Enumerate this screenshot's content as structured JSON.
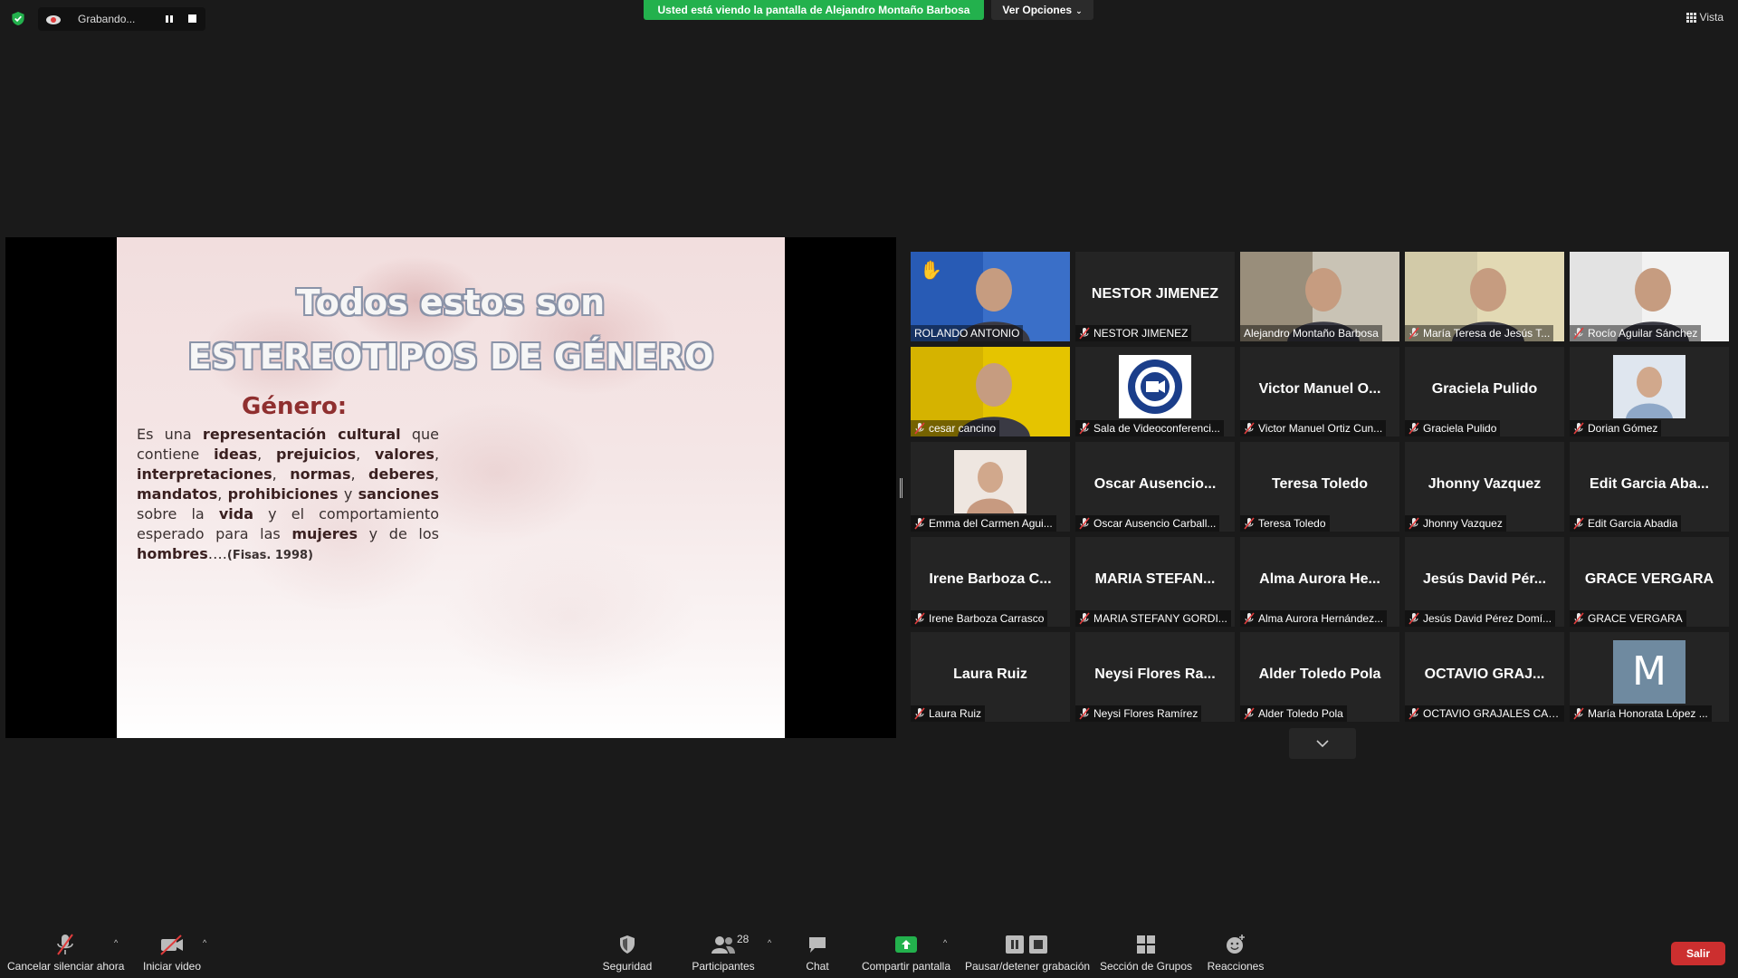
{
  "top_bar": {
    "recording_label": "Grabando...",
    "share_banner": "Usted está viendo la pantalla de Alejandro Montaño Barbosa",
    "view_options": "Ver Opciones",
    "view_label": "Vista"
  },
  "slide": {
    "title_line1": "Todos estos son",
    "title_line2": "ESTEREOTIPOS DE GÉNERO",
    "heading": "Género:",
    "body_segments": [
      {
        "text": "Es una ",
        "bold": false
      },
      {
        "text": "representación cultural",
        "bold": true
      },
      {
        "text": " que contiene ",
        "bold": false
      },
      {
        "text": "ideas",
        "bold": true
      },
      {
        "text": ", ",
        "bold": false
      },
      {
        "text": "prejuicios",
        "bold": true
      },
      {
        "text": ", ",
        "bold": false
      },
      {
        "text": "valores",
        "bold": true
      },
      {
        "text": ", ",
        "bold": false
      },
      {
        "text": "interpretaciones",
        "bold": true
      },
      {
        "text": ", ",
        "bold": false
      },
      {
        "text": "normas",
        "bold": true
      },
      {
        "text": ", ",
        "bold": false
      },
      {
        "text": "deberes",
        "bold": true
      },
      {
        "text": ", ",
        "bold": false
      },
      {
        "text": "mandatos",
        "bold": true
      },
      {
        "text": ", ",
        "bold": false
      },
      {
        "text": "prohibiciones",
        "bold": true
      },
      {
        "text": " y ",
        "bold": false
      },
      {
        "text": "sanciones",
        "bold": true
      },
      {
        "text": " sobre la ",
        "bold": false
      },
      {
        "text": "vida",
        "bold": true
      },
      {
        "text": " y el comportamiento esperado para las ",
        "bold": false
      },
      {
        "text": "mujeres",
        "bold": true
      },
      {
        "text": " y de los ",
        "bold": false
      },
      {
        "text": "hombres",
        "bold": true
      },
      {
        "text": "….",
        "bold": false
      }
    ],
    "citation": "(Fisas. 1998)"
  },
  "participants": [
    {
      "label": "ROLANDO ANTONIO",
      "big_name": "",
      "kind": "video",
      "muted": false,
      "hand_raised": true,
      "active": true,
      "video_colors": [
        "#1d4fa8",
        "#3a6fc8"
      ]
    },
    {
      "label": "NESTOR JIMENEZ",
      "big_name": "NESTOR JIMENEZ",
      "kind": "name",
      "muted": true
    },
    {
      "label": "Alejandro Montaño Barbosa",
      "big_name": "",
      "kind": "video",
      "muted": false,
      "video_colors": [
        "#7a6a55",
        "#c9c3b5"
      ]
    },
    {
      "label": "María Teresa de Jesús T...",
      "big_name": "",
      "kind": "video",
      "muted": true,
      "video_colors": [
        "#c8c0a0",
        "#e2d9b4"
      ]
    },
    {
      "label": "Rocío Aguilar Sánchez",
      "big_name": "",
      "kind": "video",
      "muted": true,
      "video_colors": [
        "#d8d8d8",
        "#f2f2f2"
      ]
    },
    {
      "label": "cesar cancino",
      "big_name": "",
      "kind": "video",
      "muted": true,
      "video_colors": [
        "#c9a800",
        "#e5c400"
      ]
    },
    {
      "label": "Sala de Videoconferenci...",
      "big_name": "",
      "kind": "logo",
      "muted": true
    },
    {
      "label": "Victor Manuel Ortiz Cun...",
      "big_name": "Victor Manuel O...",
      "kind": "name",
      "muted": true
    },
    {
      "label": "Graciela Pulido",
      "big_name": "Graciela Pulido",
      "kind": "name",
      "muted": true
    },
    {
      "label": "Dorian Gómez",
      "big_name": "",
      "kind": "small-photo",
      "muted": true,
      "video_colors": [
        "#8fa8c8",
        "#dfe6ef"
      ]
    },
    {
      "label": "Emma del Carmen Agui...",
      "big_name": "",
      "kind": "small-photo",
      "muted": true,
      "video_colors": [
        "#c79a80",
        "#eee6e0"
      ]
    },
    {
      "label": "Oscar Ausencio Carball...",
      "big_name": "Oscar Ausencio...",
      "kind": "name",
      "muted": true
    },
    {
      "label": "Teresa Toledo",
      "big_name": "Teresa Toledo",
      "kind": "name",
      "muted": true
    },
    {
      "label": "Jhonny Vazquez",
      "big_name": "Jhonny Vazquez",
      "kind": "name",
      "muted": true
    },
    {
      "label": "Edit Garcia Abadia",
      "big_name": "Edit Garcia Aba...",
      "kind": "name",
      "muted": true
    },
    {
      "label": "Irene Barboza Carrasco",
      "big_name": "Irene Barboza C...",
      "kind": "name",
      "muted": true
    },
    {
      "label": "MARIA STEFANY GORDI...",
      "big_name": "MARIA STEFAN...",
      "kind": "name",
      "muted": true
    },
    {
      "label": "Alma Aurora Hernández...",
      "big_name": "Alma Aurora He...",
      "kind": "name",
      "muted": true
    },
    {
      "label": "Jesús David Pérez Domí...",
      "big_name": "Jesús David Pér...",
      "kind": "name",
      "muted": true
    },
    {
      "label": "GRACE VERGARA",
      "big_name": "GRACE VERGARA",
      "kind": "name",
      "muted": true
    },
    {
      "label": "Laura Ruiz",
      "big_name": "Laura Ruiz",
      "kind": "name",
      "muted": true
    },
    {
      "label": "Neysi Flores Ramírez",
      "big_name": "Neysi Flores Ra...",
      "kind": "name",
      "muted": true
    },
    {
      "label": "Alder Toledo Pola",
      "big_name": "Alder Toledo Pola",
      "kind": "name",
      "muted": true
    },
    {
      "label": "OCTAVIO GRAJALES CAS...",
      "big_name": "OCTAVIO GRAJ...",
      "kind": "name",
      "muted": true
    },
    {
      "label": "María Honorata López ...",
      "big_name": "",
      "kind": "initial",
      "initial": "M",
      "muted": true
    }
  ],
  "toolbar": {
    "unmute_label": "Cancelar silenciar ahora",
    "video_label": "Iniciar video",
    "security_label": "Seguridad",
    "participants_label": "Participantes",
    "participants_count": "28",
    "chat_label": "Chat",
    "share_label": "Compartir pantalla",
    "recording_label": "Pausar/detener grabación",
    "breakout_label": "Sección de Grupos",
    "reactions_label": "Reacciones",
    "leave_label": "Salir"
  },
  "colors": {
    "share_banner": "#23b14d",
    "leave_button": "#cc2f2f",
    "active_speaker_border": "#d6dc46",
    "share_label": "#2fd35b"
  }
}
